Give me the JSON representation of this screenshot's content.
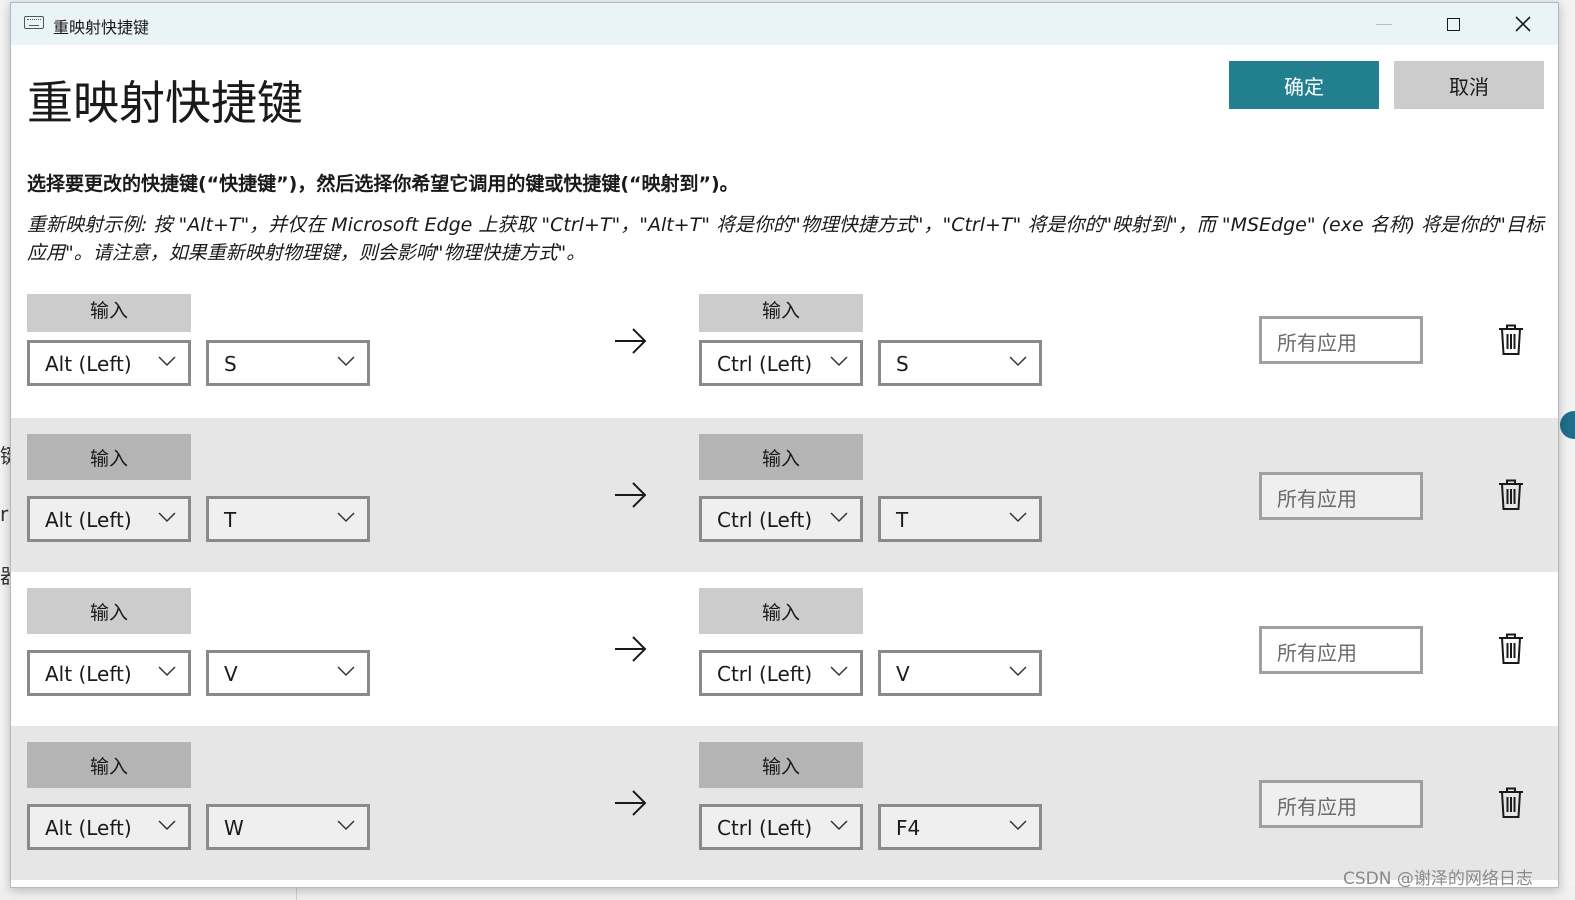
{
  "window": {
    "title": "重映射快捷键"
  },
  "header": {
    "heading": "重映射快捷键",
    "ok_label": "确定",
    "cancel_label": "取消"
  },
  "instructions": {
    "main": "选择要更改的快捷键(“快捷键”)，然后选择你希望它调用的键或快捷键(“映射到”)。",
    "example": "重新映射示例: 按 \"Alt+T\"，并仅在 Microsoft Edge 上获取 \"Ctrl+T\"，\"Alt+T\" 将是你的\"物理快捷方式\"，\"Ctrl+T\" 将是你的\"映射到\"，而 \"MSEdge\" (exe 名称) 将是你的\"目标应用\"。请注意，如果重新映射物理键，则会影响\"物理快捷方式\"。"
  },
  "rows": [
    {
      "input_label": "输入",
      "from": [
        "Alt (Left)",
        "S"
      ],
      "to": [
        "Ctrl (Left)",
        "S"
      ],
      "app_placeholder": "所有应用"
    },
    {
      "input_label": "输入",
      "from": [
        "Alt (Left)",
        "T"
      ],
      "to": [
        "Ctrl (Left)",
        "T"
      ],
      "app_placeholder": "所有应用"
    },
    {
      "input_label": "输入",
      "from": [
        "Alt (Left)",
        "V"
      ],
      "to": [
        "Ctrl (Left)",
        "V"
      ],
      "app_placeholder": "所有应用"
    },
    {
      "input_label": "输入",
      "from": [
        "Alt (Left)",
        "W"
      ],
      "to": [
        "Ctrl (Left)",
        "F4"
      ],
      "app_placeholder": "所有应用"
    }
  ],
  "background_fragments": [
    "键",
    "r",
    "器"
  ],
  "watermark": "CSDN @谢泽的网络日志",
  "colors": {
    "accent": "#227f8d",
    "secondary_button": "#cccccc",
    "row_alt": "#e6e6e6",
    "titlebar": "#eaf4f7"
  },
  "icons": [
    "keyboard-icon",
    "minimize-icon",
    "maximize-icon",
    "close-icon",
    "chevron-down-icon",
    "arrow-right-icon",
    "trash-icon"
  ]
}
